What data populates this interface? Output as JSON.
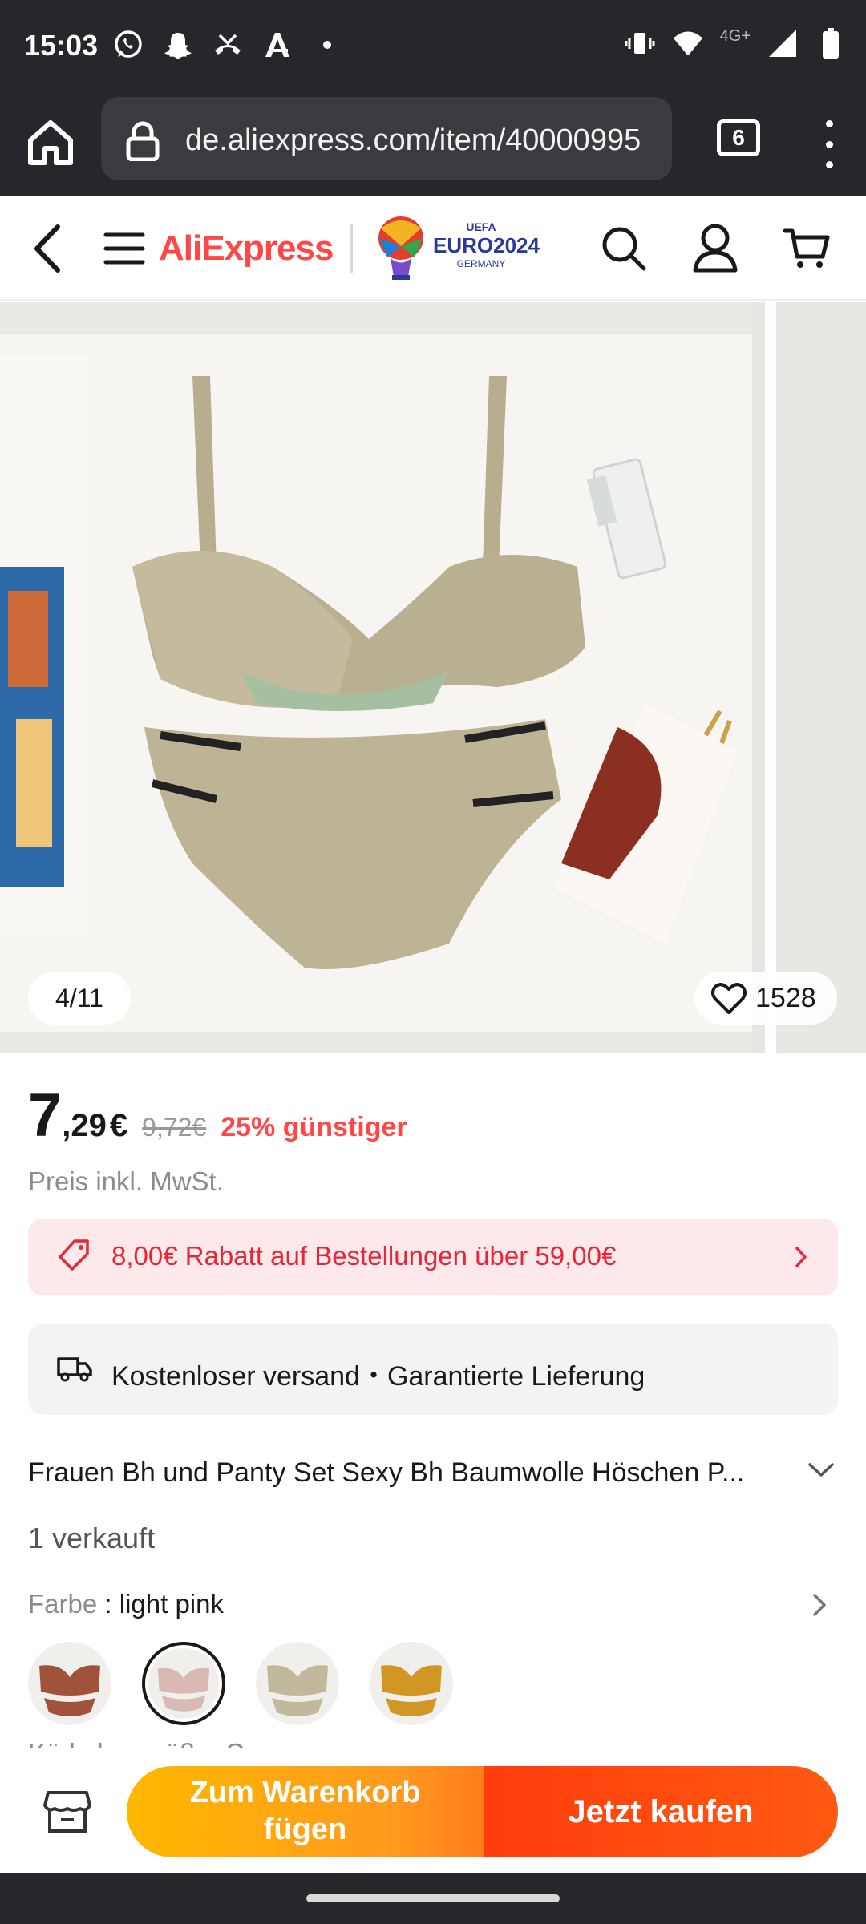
{
  "status_bar": {
    "time": "15:03",
    "notification_icons": [
      "whatsapp-icon",
      "snapchat-icon",
      "missed-call-icon",
      "translate-icon",
      "dot-icon"
    ],
    "system_icons": [
      "vibrate-icon",
      "wifi-icon",
      "4g-icon",
      "signal-icon",
      "battery-icon"
    ],
    "network": "4G+"
  },
  "browser": {
    "url": "de.aliexpress.com/item/40000995",
    "tab_count": "6"
  },
  "header": {
    "brand": "AliExpress",
    "partner_logo": {
      "line1": "UEFA",
      "line2": "EURO2024",
      "line3": "GERMANY"
    }
  },
  "gallery": {
    "counter": "4/11",
    "wishlist_count": "1528"
  },
  "price": {
    "integer": "7",
    "decimal": ",29",
    "currency": "€",
    "original": "9,72€",
    "discount": "25% günstiger",
    "tax_note": "Preis inkl. MwSt."
  },
  "coupon": {
    "text": "8,00€ Rabatt auf Bestellungen über 59,00€"
  },
  "shipping": {
    "text": "Kostenloser versand・Garantierte Lieferung"
  },
  "product": {
    "title": "Frauen Bh und Panty Set Sexy Bh Baumwolle Höschen P...",
    "sold": "1 verkauft",
    "color_label": "Farbe",
    "color_separator": " : ",
    "color_value": "light pink",
    "swatches": [
      "brown",
      "light pink",
      "khaki",
      "mustard"
    ],
    "next_option_label": "Körbchengröße: C"
  },
  "actions": {
    "cart_line1": "Zum Warenkorb",
    "cart_line2": "fügen",
    "buy": "Jetzt kaufen"
  },
  "colors": {
    "brand_red": "#ff4747",
    "cart_gradient_start": "#ffb800",
    "buy_orange": "#ff3d0c",
    "coupon_bg": "#fde9ea",
    "chrome_dark": "#26262b"
  }
}
